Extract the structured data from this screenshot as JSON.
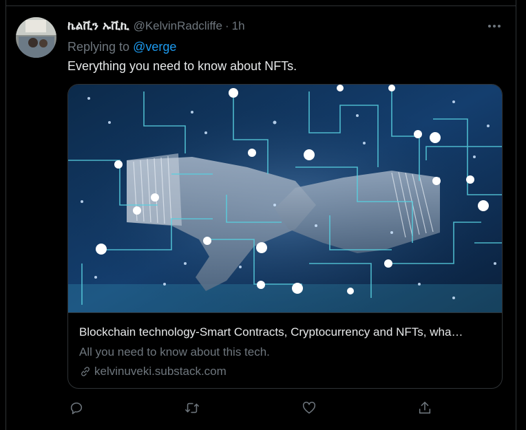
{
  "tweet": {
    "author_name": "ኬልቪን ኡቪኪ",
    "author_handle": "@KelvinRadcliffe",
    "separator": "·",
    "time": "1h",
    "reply_prefix": "Replying to",
    "reply_to": "@verge",
    "text": "Everything you need to know about NFTs."
  },
  "card": {
    "title": "Blockchain technology-Smart Contracts, Cryptocurrency and NFTs, wha…",
    "description": "All you need to know about this tech.",
    "domain": "kelvinuveki.substack.com"
  },
  "actions": {
    "icons": [
      "reply-icon",
      "retweet-icon",
      "like-icon",
      "share-icon"
    ]
  },
  "colors": {
    "background": "#000000",
    "text_primary": "#e7e9ea",
    "text_secondary": "#6e767d",
    "accent": "#1d9bf0",
    "border": "#2f3336"
  }
}
